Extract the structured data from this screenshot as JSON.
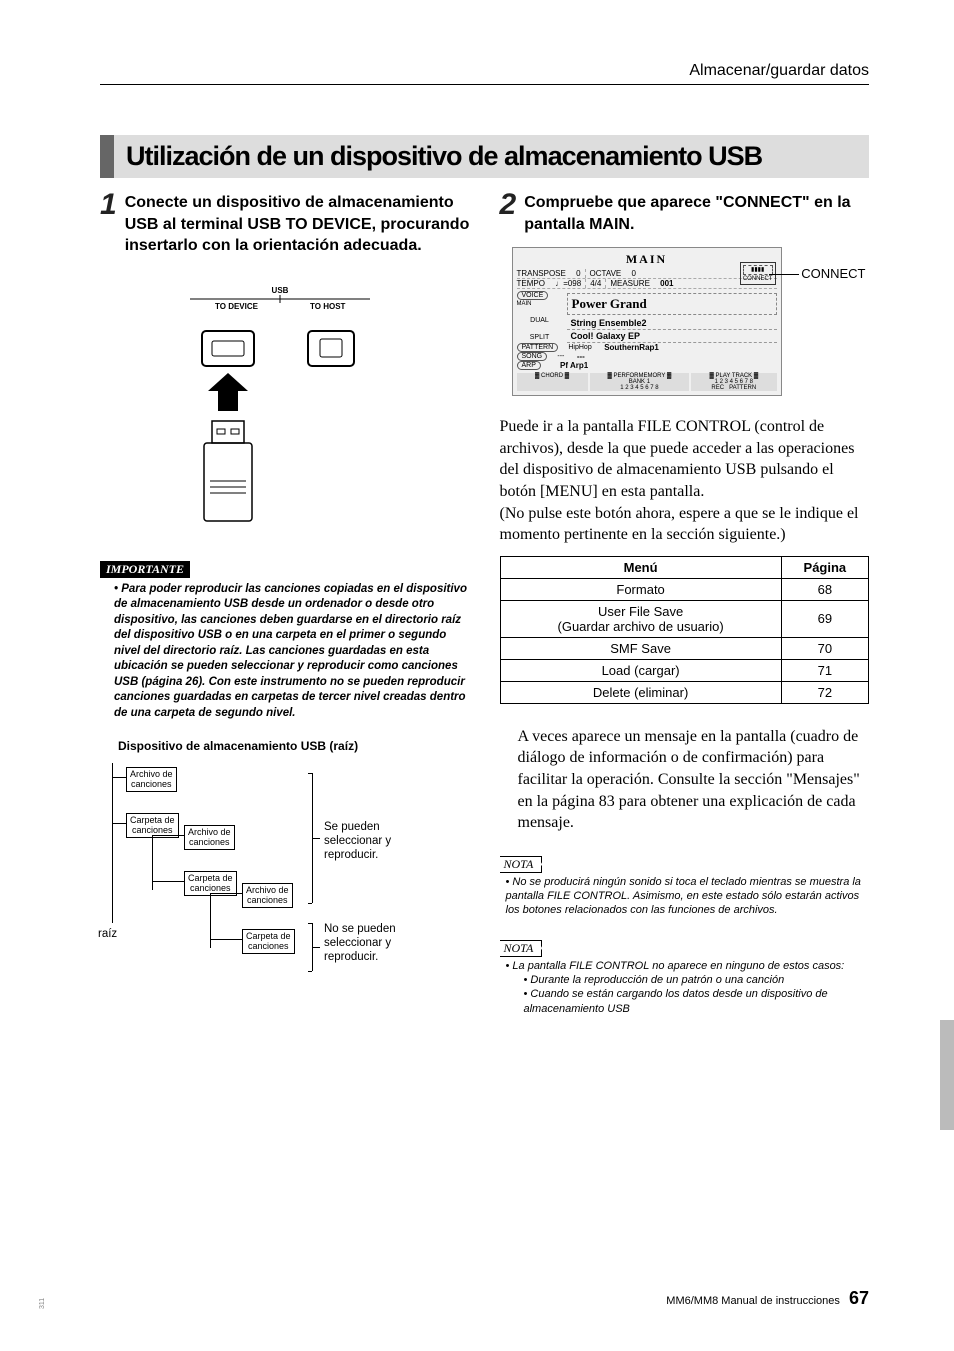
{
  "header": {
    "section": "Almacenar/guardar datos"
  },
  "title": "Utilización de un dispositivo de almacenamiento USB",
  "step1": {
    "num": "1",
    "text": "Conecte un dispositivo de almacenamiento USB al terminal USB TO DEVICE, procurando insertarlo con la orientación adecuada."
  },
  "diagram1": {
    "usb": "USB",
    "to_device": "TO DEVICE",
    "to_host": "TO HOST"
  },
  "importante": {
    "label": "IMPORTANTE",
    "text": "• Para poder reproducir las canciones copiadas en el dispositivo de almacenamiento USB desde un ordenador o desde otro dispositivo, las canciones deben guardarse en el directorio raíz del dispositivo USB o en una carpeta en el primer o segundo nivel del directorio raíz. Las canciones guardadas en esta ubicación se pueden seleccionar y reproducir como canciones USB (página 26). Con este instrumento no se pueden reproducir canciones guardadas en carpetas de tercer nivel creadas dentro de una carpeta de segundo nivel."
  },
  "tree": {
    "heading": "Dispositivo de almacenamiento USB (raíz)",
    "root": "raíz",
    "songfile": "Archivo de\ncanciones",
    "songfolder": "Carpeta de\ncanciones",
    "can": "Se pueden seleccionar y reproducir.",
    "cannot": "No se pueden seleccionar y reproducir."
  },
  "step2": {
    "num": "2",
    "text": "Compruebe que aparece \"CONNECT\" en la pantalla MAIN."
  },
  "lcd": {
    "title": "MAIN",
    "rows": {
      "transpose": "TRANSPOSE",
      "transpose_v": "0",
      "octave": "OCTAVE",
      "octave_v": "0",
      "tempo": "TEMPO",
      "tempo_v": "♩=098",
      "sig": "4/4",
      "measure": "MEASURE",
      "measure_v": "001"
    },
    "connect": "CONNECT",
    "labels": {
      "voice": "VOICE",
      "main": "MAIN",
      "dual": "DUAL",
      "split": "SPLIT",
      "pattern": "PATTERN",
      "song": "SONG",
      "arp": "ARP"
    },
    "mainvoice": "Power Grand",
    "dualvoice": "String Ensemble2",
    "splitvoice": "Cool! Galaxy EP",
    "pattern": "HipHop",
    "patternv": "SouthernRap1",
    "song": "---",
    "songv": "---",
    "arpv": "Pf Arp1",
    "footer": {
      "chord": "CHORD",
      "perf": "PERFORMEMORY",
      "play": "PLAY TRACK",
      "bank": "BANK 1",
      "nums": "1 2 3 4 5 6 7 8",
      "rec": "REC",
      "nums2": "1 2 3 4 5 6 7 8",
      "patt": "PATTERN"
    },
    "callout": "CONNECT"
  },
  "para1": "Puede ir a la pantalla FILE CONTROL (control de archivos), desde la que puede acceder a las operaciones del dispositivo de almacenamiento USB pulsando el botón [MENU] en esta pantalla.",
  "para2": "(No pulse este botón ahora, espere a que se le indique el momento pertinente en la sección siguiente.)",
  "table": {
    "h1": "Menú",
    "h2": "Página",
    "rows": [
      [
        "Formato",
        "68"
      ],
      [
        "User File Save\n(Guardar archivo de usuario)",
        "69"
      ],
      [
        "SMF Save",
        "70"
      ],
      [
        "Load (cargar)",
        "71"
      ],
      [
        "Delete (eliminar)",
        "72"
      ]
    ]
  },
  "callout2": "A veces aparece un mensaje en la pantalla (cuadro de diálogo de información o de confirmación) para facilitar la operación. Consulte la sección \"Mensajes\" en la página 83 para obtener una explicación de cada mensaje.",
  "nota1": {
    "label": "NOTA",
    "text": "• No se producirá ningún sonido si toca el teclado mientras se muestra la pantalla FILE CONTROL. Asimismo, en este estado sólo estarán activos los botones relacionados con las funciones de archivos."
  },
  "nota2": {
    "label": "NOTA",
    "intro": "• La pantalla FILE CONTROL no aparece en ninguno de estos casos:",
    "b1": "• Durante la reproducción de un patrón o una canción",
    "b2": "• Cuando se están cargando los datos desde un dispositivo de almacenamiento USB"
  },
  "footer": {
    "doc": "MM6/MM8  Manual de instrucciones",
    "page": "67"
  },
  "sidecode": "311"
}
